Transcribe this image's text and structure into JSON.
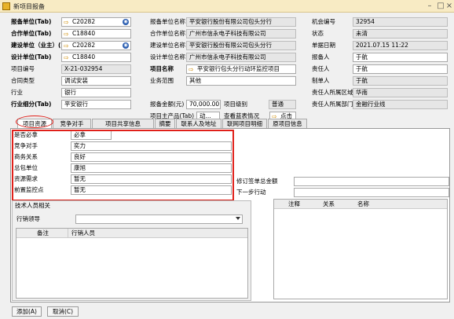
{
  "window": {
    "title": "新项目报备"
  },
  "colA": [
    {
      "label": "报备单位(Tab)",
      "bold": true,
      "value": "C20282",
      "arrow": true,
      "blue": true
    },
    {
      "label": "合作单位(Tab)",
      "bold": true,
      "value": "C18840",
      "arrow": true
    },
    {
      "label": "建设单位（业主）(",
      "bold": true,
      "value": "C20282",
      "arrow": true,
      "blue": true
    },
    {
      "label": "设计单位(Tab)",
      "bold": true,
      "value": "C18840",
      "arrow": true
    },
    {
      "label": "项目编号",
      "bold": false,
      "value": "X-21-032954",
      "ro": true
    },
    {
      "label": "合同类型",
      "bold": false,
      "value": "调试安装",
      "dd": true
    },
    {
      "label": "行业",
      "bold": false,
      "value": "银行",
      "dd": true
    },
    {
      "label": "行业细分(Tab)",
      "bold": true,
      "value": "平安银行"
    }
  ],
  "colB": [
    {
      "label": "报备单位名称",
      "value": "平安银行股份有限公司包头分行"
    },
    {
      "label": "合作单位名称",
      "value": "广州市信永电子科技有限公司"
    },
    {
      "label": "建设单位名称",
      "value": "平安银行股份有限公司包头分行"
    },
    {
      "label": "设计单位名称",
      "value": "广州市信永电子科技有限公司"
    },
    {
      "label": "项目名称",
      "bold": true,
      "value": "平安银行包头分行动环监控项目",
      "arrow": true
    },
    {
      "label": "业务范围",
      "value": "其他"
    }
  ],
  "row7": {
    "amount_label": "报备金额(元)",
    "amount": "70,000.00",
    "level_label": "项目级别",
    "level": "普通"
  },
  "row8": {
    "product_label": "项目主产品(Tab)",
    "product": "动...",
    "check_label": "查看蓝表情况",
    "click_label": "点击"
  },
  "colC": [
    {
      "label": "机会编号",
      "value": "32954",
      "ro": true
    },
    {
      "label": "状态",
      "value": "未清",
      "ro": true
    },
    {
      "label": "单据日期",
      "value": "2021.07.15 11:22",
      "ro": true,
      "dd": true
    },
    {
      "label": "报备人",
      "value": "于航",
      "dd": true
    },
    {
      "label": "责任人",
      "value": "于航",
      "dd": true
    },
    {
      "label": "制单人",
      "value": "于航",
      "ro": true
    },
    {
      "label": "责任人所属区域",
      "value": "华南",
      "ro": true
    },
    {
      "label": "责任人所属部门",
      "value": "金融行业线",
      "ro": true
    }
  ],
  "tabs": [
    "项目资源",
    "竞争对手",
    "项目共享信息",
    "摘要",
    "联系人及地址",
    "联网项目明细",
    "原项目信息"
  ],
  "resources": [
    {
      "label": "是否必拿",
      "value": "必拿",
      "dd": true
    },
    {
      "label": "竞争对手",
      "value": "奕力"
    },
    {
      "label": "商务关系",
      "value": "良好"
    },
    {
      "label": "总包单位",
      "value": "康旭"
    },
    {
      "label": "资源需求",
      "value": "暂无"
    },
    {
      "label": "前置监控点",
      "value": "暂无"
    }
  ],
  "right_fields": {
    "amount_label": "修订签单总金额",
    "next_label": "下一步行动"
  },
  "tech": {
    "header": "技术人员相关",
    "lead_label": "行销领导",
    "cols": [
      "备注",
      "行销人员"
    ]
  },
  "notes": {
    "cols": [
      "注释",
      "关系",
      "名称"
    ]
  },
  "buttons": {
    "add": "添加(A)",
    "cancel": "取消(C)"
  },
  "colors": {
    "highlight": "#e0201a",
    "accent": "#d08a00"
  }
}
